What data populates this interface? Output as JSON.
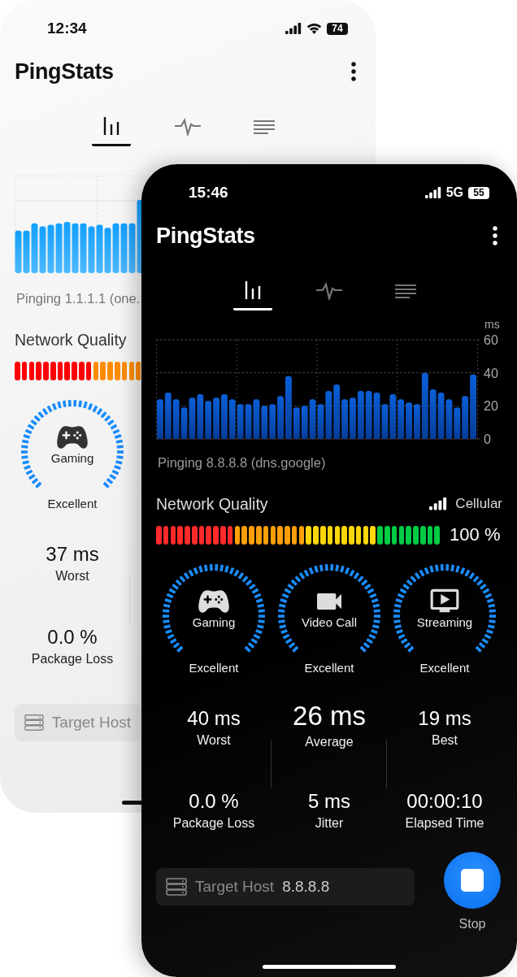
{
  "back_phone": {
    "status_bar": {
      "time": "12:34",
      "battery": "74"
    },
    "title": "PingStats",
    "tabs": [
      {
        "kind": "bars",
        "selected": true
      },
      {
        "kind": "pulse",
        "selected": false
      },
      {
        "kind": "lines",
        "selected": false
      }
    ],
    "chart": {
      "kind": "picture"
    },
    "pinging": "Pinging 1.1.1.1 (one.",
    "quality": {
      "title": "Network Quality"
    },
    "gauges": [
      {
        "kind": "gaming",
        "label": "Gaming",
        "rating": "Excellent"
      }
    ],
    "stats": [
      [
        {
          "value": "37 ms",
          "label": "Worst",
          "large": false
        },
        {
          "value": "0.0 %",
          "label": "Package Loss",
          "large": false
        }
      ]
    ],
    "target_host": {
      "label": "Target Host"
    }
  },
  "front_phone": {
    "status_bar": {
      "time": "15:46",
      "network": "5G",
      "battery": "55"
    },
    "title": "PingStats",
    "tabs": [
      {
        "kind": "bars",
        "selected": true
      },
      {
        "kind": "pulse",
        "selected": false
      },
      {
        "kind": "lines",
        "selected": false
      }
    ],
    "chart": {
      "chart_data": {
        "type": "bar",
        "ylabel": "ms",
        "ylim": [
          0,
          60
        ],
        "yticks": [
          0,
          20,
          40,
          60
        ],
        "grid": true,
        "values": [
          24,
          28,
          24,
          19,
          25,
          27,
          23,
          25,
          27,
          24,
          21,
          21,
          24,
          20,
          21,
          26,
          38,
          19,
          20,
          24,
          21,
          29,
          33,
          24,
          25,
          29,
          29,
          28,
          21,
          27,
          24,
          22,
          21,
          40,
          30,
          28,
          24,
          19,
          26,
          39
        ]
      }
    },
    "pinging": "Pinging 8.8.8.8 (dns.google)",
    "quality": {
      "title": "Network Quality",
      "connection": "Cellular",
      "reading": "100 %"
    },
    "gauges": [
      {
        "kind": "gaming",
        "label": "Gaming",
        "rating": "Excellent"
      },
      {
        "kind": "video",
        "label": "Video Call",
        "rating": "Excellent"
      },
      {
        "kind": "streaming",
        "label": "Streaming",
        "rating": "Excellent"
      }
    ],
    "stats": [
      [
        {
          "value": "40 ms",
          "label": "Worst",
          "large": false
        },
        {
          "value": "0.0 %",
          "label": "Package Loss",
          "large": false
        }
      ],
      [
        {
          "value": "26 ms",
          "label": "Average",
          "large": true
        },
        {
          "value": "5 ms",
          "label": "Jitter",
          "large": false
        }
      ],
      [
        {
          "value": "19 ms",
          "label": "Best",
          "large": false
        },
        {
          "value": "00:00:10",
          "label": "Elapsed Time",
          "large": false
        }
      ]
    ],
    "target_host": {
      "label": "Target Host",
      "value": "8.8.8.8"
    },
    "stop_button": {
      "label": "Stop"
    }
  }
}
